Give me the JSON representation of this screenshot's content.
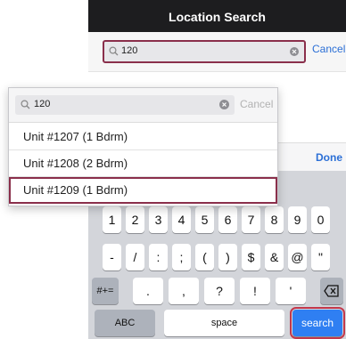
{
  "background_screen": {
    "title": "Location Search",
    "search": {
      "value": "120"
    },
    "cancel_label": "Cancel",
    "done_label": "Done"
  },
  "popup": {
    "search_value": "120",
    "cancel_label": "Cancel",
    "results": [
      {
        "label": "Unit #1207 (1 Bdrm)",
        "selected": false
      },
      {
        "label": "Unit #1208 (2 Bdrm)",
        "selected": false
      },
      {
        "label": "Unit #1209 (1 Bdrm)",
        "selected": true
      }
    ]
  },
  "keyboard": {
    "row1": [
      "1",
      "2",
      "3",
      "4",
      "5",
      "6",
      "7",
      "8",
      "9",
      "0"
    ],
    "row2": [
      "-",
      "/",
      ":",
      ";",
      "(",
      ")",
      "$",
      "&",
      "@",
      "\""
    ],
    "row3_left": "#+=",
    "row3": [
      ".",
      ",",
      "?",
      "!",
      "'"
    ],
    "abc_label": "ABC",
    "space_label": "space",
    "search_label": "search"
  },
  "colors": {
    "highlight": "#8a2f4b",
    "accent_blue": "#2f7ff2",
    "navbar": "#1d1d1f"
  },
  "icons": [
    "search-icon",
    "clear-icon",
    "backspace-icon"
  ]
}
